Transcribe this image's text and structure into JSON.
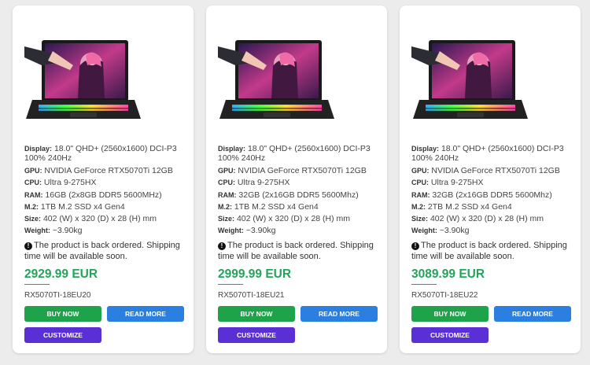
{
  "labels": {
    "display": "Display:",
    "gpu": "GPU:",
    "cpu": "CPU:",
    "ram": "RAM:",
    "m2": "M.2:",
    "size": "Size:",
    "weight": "Weight:"
  },
  "products": [
    {
      "display": "18.0\" QHD+ (2560x1600) DCI-P3 100% 240Hz",
      "gpu": "NVIDIA GeForce RTX5070Ti 12GB",
      "cpu": "Ultra 9-275HX",
      "ram": "16GB (2x8GB DDR5 5600MHz)",
      "m2": "1TB M.2 SSD x4 Gen4",
      "size": "402 (W) x 320 (D) x 28 (H) mm",
      "weight": "~3.90kg",
      "notice": "The product is back ordered. Shipping time will be available soon.",
      "price": "2929.99 EUR",
      "sku": "RX5070TI-18EU20",
      "buy": "BUY NOW",
      "read": "READ MORE",
      "customize": "CUSTOMIZE"
    },
    {
      "display": "18.0\" QHD+ (2560x1600) DCI-P3 100% 240Hz",
      "gpu": "NVIDIA GeForce RTX5070Ti 12GB",
      "cpu": "Ultra 9-275HX",
      "ram": "32GB (2x16GB DDR5 5600Mhz)",
      "m2": "1TB M.2 SSD x4 Gen4",
      "size": "402 (W) x 320 (D) x 28 (H) mm",
      "weight": "~3.90kg",
      "notice": "The product is back ordered. Shipping time will be available soon.",
      "price": "2999.99 EUR",
      "sku": "RX5070TI-18EU21",
      "buy": "BUY NOW",
      "read": "READ MORE",
      "customize": "CUSTOMIZE"
    },
    {
      "display": "18.0\" QHD+ (2560x1600) DCI-P3 100% 240Hz",
      "gpu": "NVIDIA GeForce RTX5070Ti 12GB",
      "cpu": "Ultra 9-275HX",
      "ram": "32GB (2x16GB DDR5 5600Mhz)",
      "m2": "2TB M.2 SSD x4 Gen4",
      "size": "402 (W) x 320 (D) x 28 (H) mm",
      "weight": "~3.90kg",
      "notice": "The product is back ordered. Shipping time will be available soon.",
      "price": "3089.99 EUR",
      "sku": "RX5070TI-18EU22",
      "buy": "BUY NOW",
      "read": "READ MORE",
      "customize": "CUSTOMIZE"
    }
  ],
  "colors": {
    "price": "#23a45a",
    "buy_button": "#1fa34a",
    "read_button": "#2a7fe0",
    "customize_button": "#5a2fd6"
  }
}
